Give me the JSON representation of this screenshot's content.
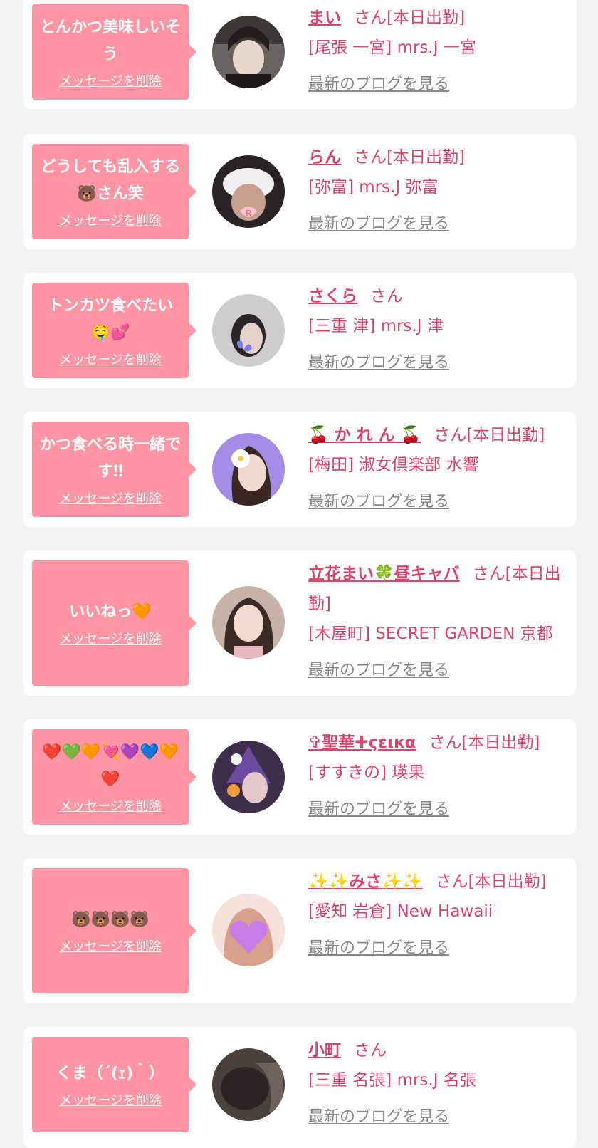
{
  "colors": {
    "accent": "#e0426a",
    "bubble": "#fd95a5",
    "page_bg": "#f3f3f3",
    "link_gray": "#888888"
  },
  "blog_link_label": "最新のブログを見る",
  "delete_label": "メッセージを削除",
  "items": [
    {
      "message": "とんかつ美味しいそう",
      "name": "まい",
      "suffix": "さん[本日出勤]",
      "store": "[尾張 一宮] mrs.J 一宮",
      "avatar": "avatar-photo"
    },
    {
      "message": "どうしても乱入する🐻さん笑",
      "name": "らん",
      "suffix": "さん[本日出勤]",
      "store": "[弥富] mrs.J 弥富",
      "avatar": "avatar-photo"
    },
    {
      "message": "トンカツ食べたい 🤤💕",
      "name": "さくら",
      "suffix": "さん",
      "store": "[三重 津] mrs.J 津",
      "avatar": "avatar-photo"
    },
    {
      "message": "かつ食べる時一緒です‼",
      "name": "🍒 か れ ん 🍒",
      "suffix": "さん[本日出勤]",
      "store": "[梅田] 淑女倶楽部 水響",
      "avatar": "avatar-photo"
    },
    {
      "message": "いいねっ🧡",
      "name": "立花まい🍀昼キャバ",
      "suffix": "さん[本日出勤]",
      "store": "[木屋町] SECRET GARDEN 京都",
      "avatar": "avatar-photo"
    },
    {
      "message": "❤️💚🧡💘💜💙🧡❤️",
      "name": "✞聖華✚ϛειкα",
      "suffix": "さん[本日出勤]",
      "store": "[すすきの] 瑛果",
      "avatar": "avatar-photo"
    },
    {
      "message": "🐻🐻🐻🐻",
      "name": "✨✨みさ✨✨",
      "suffix": "さん[本日出勤]",
      "store": "[愛知 岩倉] New Hawaii",
      "avatar": "avatar-photo"
    },
    {
      "message": "くま（´(ｪ)｀）",
      "name": "小町",
      "suffix": "さん",
      "store": "[三重 名張] mrs.J 名張",
      "avatar": "avatar-photo"
    }
  ]
}
